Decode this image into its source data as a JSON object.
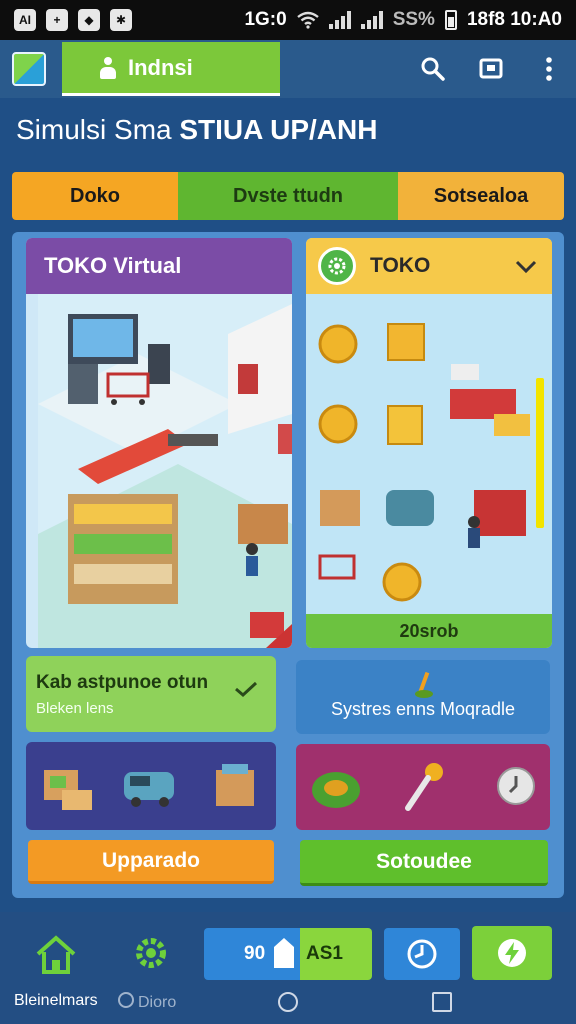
{
  "status_bar": {
    "left_icons": [
      "ai-icon",
      "plus-icon",
      "compass-icon",
      "shield-icon"
    ],
    "left_icon_text": [
      "AI",
      "+",
      "◆",
      "✱"
    ],
    "time_left": "1G:0",
    "battery_text": "SS%",
    "time_right": "18f8 10:A0"
  },
  "app_bar": {
    "tab_label": "Indnsi"
  },
  "page": {
    "title_light": "Simulsi Sma ",
    "title_bold": "STIUA UP/ANH"
  },
  "tabs": [
    {
      "label": "Doko"
    },
    {
      "label": "Dvste ttudn"
    },
    {
      "label": "Sotsealoa"
    }
  ],
  "card_left": {
    "title": "TOKO Virtual"
  },
  "card_right": {
    "title": "TOKO",
    "footer": "20srob"
  },
  "card_green": {
    "line1": "Kab astpunoe otun",
    "line2": "Bleken lens"
  },
  "card_blue": {
    "label": "Systres enns Moqradle"
  },
  "buttons": {
    "upgrade": "Upparado",
    "right": "Sotoudee"
  },
  "bottom_nav": {
    "label_1": "Bleinelmars",
    "label_2": "Dioro",
    "counter_a": "90",
    "counter_b": "AS1"
  },
  "colors": {
    "accent_green": "#7cc83a",
    "accent_orange": "#f39a24",
    "header_purple": "#7b4ca6",
    "header_yellow": "#f6c94a"
  }
}
